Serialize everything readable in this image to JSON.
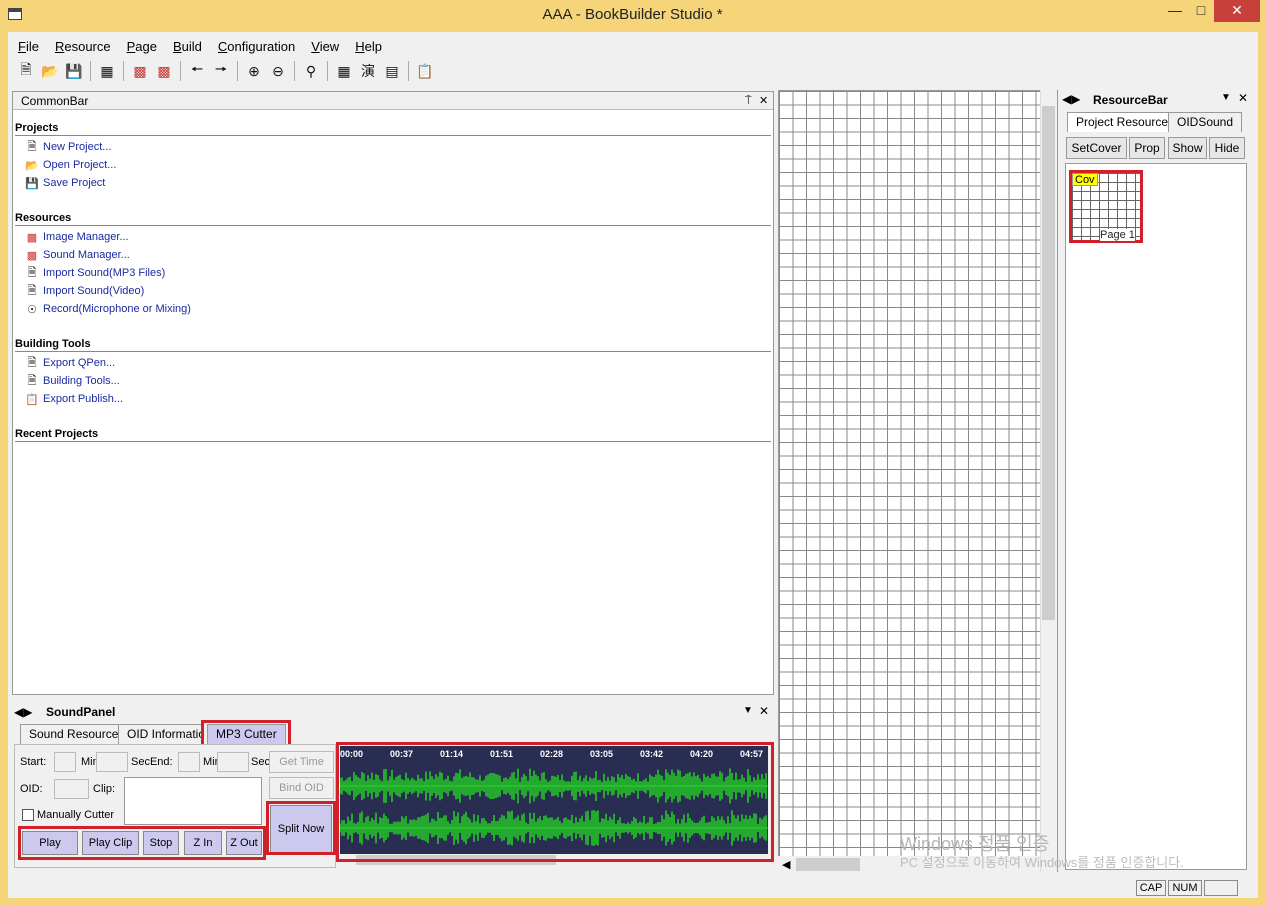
{
  "window": {
    "title": "AAA - BookBuilder Studio *",
    "min": "—",
    "max": "□",
    "close": "✕"
  },
  "menu": [
    {
      "label": "File",
      "key": "F",
      "rest": "ile"
    },
    {
      "label": "Resource",
      "key": "R",
      "rest": "esource"
    },
    {
      "label": "Page",
      "key": "P",
      "rest": "age"
    },
    {
      "label": "Build",
      "key": "B",
      "rest": "uild"
    },
    {
      "label": "Configuration",
      "key": "C",
      "rest": "onfiguration"
    },
    {
      "label": "View",
      "key": "V",
      "rest": "iew"
    },
    {
      "label": "Help",
      "key": "H",
      "rest": "elp"
    }
  ],
  "toolbar": [
    "new-icon",
    "open-icon",
    "save-icon",
    "properties-icon",
    "image-manager-icon",
    "sound-manager-icon",
    "back-icon",
    "forward-icon",
    "zoom-in-icon",
    "zoom-out-icon",
    "find-icon",
    "blk-icon",
    "chinese-icon",
    "export-icon",
    "clipboard-icon"
  ],
  "commonbar": {
    "title": "CommonBar",
    "pin": "⍑",
    "close": "✕",
    "sections": {
      "projects": "Projects",
      "resources": "Resources",
      "building": "Building Tools",
      "recent": "Recent Projects"
    },
    "links": {
      "new_project": "New Project...",
      "open_project": "Open Project...",
      "save_project": "Save Project",
      "image_manager": "Image Manager...",
      "sound_manager": "Sound Manager...",
      "import_mp3": "Import Sound(MP3 Files)",
      "import_video": "Import Sound(Video)",
      "record": "Record(Microphone or Mixing)",
      "export_qpen": "Export QPen...",
      "building_tools": "Building Tools...",
      "export_publish": "Export Publish..."
    }
  },
  "resourcebar": {
    "title": "ResourceBar",
    "tabs": [
      "Project Resource",
      "OIDSound"
    ],
    "buttons": [
      "SetCover",
      "Prop",
      "Show",
      "Hide"
    ],
    "cover_tag": "Cov",
    "page_label": "Page 1"
  },
  "soundpanel": {
    "title": "SoundPanel",
    "tabs": [
      "Sound Resource",
      "OID Information",
      "MP3 Cutter"
    ],
    "labels": {
      "start": "Start:",
      "min1": "Min",
      "secend": "SecEnd:",
      "min2": "Min",
      "sec": "Sec",
      "oid": "OID:",
      "clip": "Clip:",
      "manual": "Manually Cutter"
    },
    "buttons": {
      "play": "Play",
      "play_clip": "Play Clip",
      "stop": "Stop",
      "zin": "Z In",
      "zout": "Z Out",
      "get_time": "Get Time",
      "bind_oid": "Bind OID",
      "split_now": "Split Now"
    },
    "timeline": [
      "00:00",
      "00:37",
      "01:14",
      "01:51",
      "02:28",
      "03:05",
      "03:42",
      "04:20",
      "04:57"
    ],
    "wave_color": "#22dd22"
  },
  "status": {
    "cap": "CAP",
    "num": "NUM"
  },
  "watermark": {
    "line1": "Windows 정품 인증",
    "line2": "PC 설정으로 이동하여 Windows를 정품 인증합니다."
  }
}
